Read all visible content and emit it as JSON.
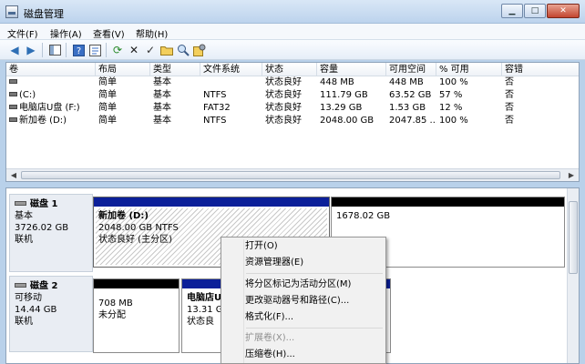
{
  "window": {
    "title": "磁盘管理",
    "minimize": "▁",
    "maximize": "□",
    "close": "✕"
  },
  "menu": [
    "文件(F)",
    "操作(A)",
    "查看(V)",
    "帮助(H)"
  ],
  "volume_table": {
    "headers": [
      "卷",
      "布局",
      "类型",
      "文件系统",
      "状态",
      "容量",
      "可用空间",
      "% 可用",
      "容错"
    ],
    "rows": [
      {
        "volume": "",
        "layout": "简单",
        "type": "基本",
        "fs": "",
        "status": "状态良好",
        "capacity": "448 MB",
        "free": "448 MB",
        "pct": "100 %",
        "fault": "否"
      },
      {
        "volume": "(C:)",
        "layout": "简单",
        "type": "基本",
        "fs": "NTFS",
        "status": "状态良好",
        "capacity": "111.79 GB",
        "free": "63.52 GB",
        "pct": "57 %",
        "fault": "否"
      },
      {
        "volume": "电脑店U盘 (F:)",
        "layout": "简单",
        "type": "基本",
        "fs": "FAT32",
        "status": "状态良好",
        "capacity": "13.29 GB",
        "free": "1.53 GB",
        "pct": "12 %",
        "fault": "否"
      },
      {
        "volume": "新加卷 (D:)",
        "layout": "简单",
        "type": "基本",
        "fs": "NTFS",
        "status": "状态良好",
        "capacity": "2048.00 GB",
        "free": "2047.85 ...",
        "pct": "100 %",
        "fault": "否"
      }
    ]
  },
  "disks": [
    {
      "name": "磁盘 1",
      "kind": "基本",
      "size": "3726.02 GB",
      "state": "联机",
      "partitions": [
        {
          "name": "新加卷  (D:)",
          "detail": "2048.00 GB NTFS",
          "status": "状态良好 (主分区)"
        },
        {
          "name": "",
          "detail": "1678.02 GB",
          "status": ""
        }
      ]
    },
    {
      "name": "磁盘 2",
      "kind": "可移动",
      "size": "14.44 GB",
      "state": "联机",
      "partitions": [
        {
          "name": "",
          "detail": "708 MB",
          "status": "未分配"
        },
        {
          "name": "电脑店U盘",
          "detail": "13.31 GB",
          "status": "状态良"
        }
      ]
    }
  ],
  "context_menu": [
    {
      "label": "打开(O)",
      "enabled": true
    },
    {
      "label": "资源管理器(E)",
      "enabled": true
    },
    {
      "label": "将分区标记为活动分区(M)",
      "enabled": true
    },
    {
      "label": "更改驱动器号和路径(C)...",
      "enabled": true
    },
    {
      "label": "格式化(F)...",
      "enabled": true
    },
    {
      "label": "扩展卷(X)...",
      "enabled": false
    },
    {
      "label": "压缩卷(H)...",
      "enabled": true
    }
  ],
  "colors": {
    "primary_partition": "#0b1f99",
    "unallocated": "#000000"
  }
}
